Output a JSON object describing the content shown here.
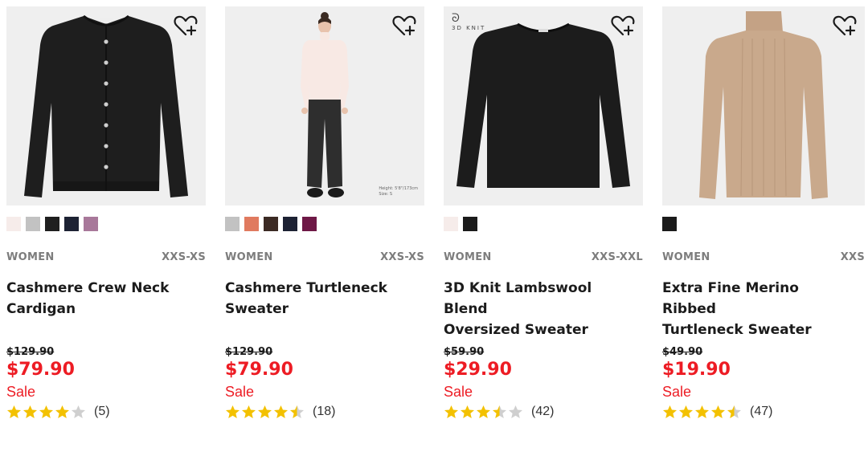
{
  "colors": {
    "sale": "#ed1c24",
    "star": "#f3c100",
    "star_empty": "#cfcfcf",
    "image_bg": "#efefef"
  },
  "products": [
    {
      "category": "WOMEN",
      "sizes": "XXS-XS",
      "title_line1": "Cashmere Crew Neck",
      "title_line2": "Cardigan",
      "original_price": "$129.90",
      "price": "$79.90",
      "sale_label": "Sale",
      "rating": 4.0,
      "reviews": "(5)",
      "swatches": [
        "#f6ecea",
        "#c2c2c2",
        "#1f1f1f",
        "#1d2233",
        "#a8789a"
      ],
      "icon": "heart-plus-icon"
    },
    {
      "category": "WOMEN",
      "sizes": "XXS-XS",
      "title_line1": "Cashmere Turtleneck",
      "title_line2": "Sweater",
      "original_price": "$129.90",
      "price": "$79.90",
      "sale_label": "Sale",
      "rating": 4.5,
      "reviews": "(18)",
      "swatches": [
        "#c2c2c2",
        "#e07a5f",
        "#3b2a24",
        "#1d2233",
        "#6e1846"
      ],
      "model_note_1": "Height: 5'8\"/173cm",
      "model_note_2": "Size: S",
      "icon": "heart-plus-icon"
    },
    {
      "category": "WOMEN",
      "sizes": "XXS-XXL",
      "title_line1": "3D Knit Lambswool Blend",
      "title_line2": "Oversized Sweater",
      "original_price": "$59.90",
      "price": "$29.90",
      "sale_label": "Sale",
      "rating": 3.5,
      "reviews": "(42)",
      "swatches": [
        "#f6ecea",
        "#1b1b1b"
      ],
      "badge": "3D KNIT",
      "icon": "heart-plus-icon"
    },
    {
      "category": "WOMEN",
      "sizes": "XXS",
      "title_line1": "Extra Fine Merino Ribbed",
      "title_line2": "Turtleneck Sweater",
      "original_price": "$49.90",
      "price": "$19.90",
      "sale_label": "Sale",
      "rating": 4.5,
      "reviews": "(47)",
      "swatches": [
        "#1b1b1b"
      ],
      "icon": "heart-plus-icon"
    }
  ]
}
